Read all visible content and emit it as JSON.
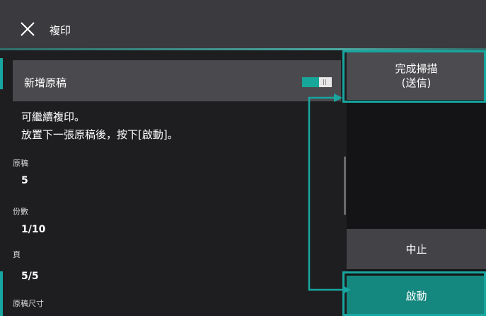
{
  "header": {
    "title": "複印",
    "close_icon": "close-icon"
  },
  "toggle_row": {
    "label": "新增原稿",
    "toggle_state": "on"
  },
  "message": {
    "line1": "可繼續複印。",
    "line2": "放置下一張原稿後，按下[啟動]。"
  },
  "fields": {
    "originals_label": "原稿",
    "originals_value": "5",
    "copies_label": "份數",
    "copies_value": "1/10",
    "pages_label": "頁",
    "pages_value": "5/5",
    "size_label": "原稿尺寸"
  },
  "buttons": {
    "finish": "完成掃描\n(送信)",
    "stop": "中止",
    "start": "啟動"
  },
  "colors": {
    "accent": "#18a6a0",
    "start_button": "#14877e",
    "toggle_on": "#16a79a"
  }
}
